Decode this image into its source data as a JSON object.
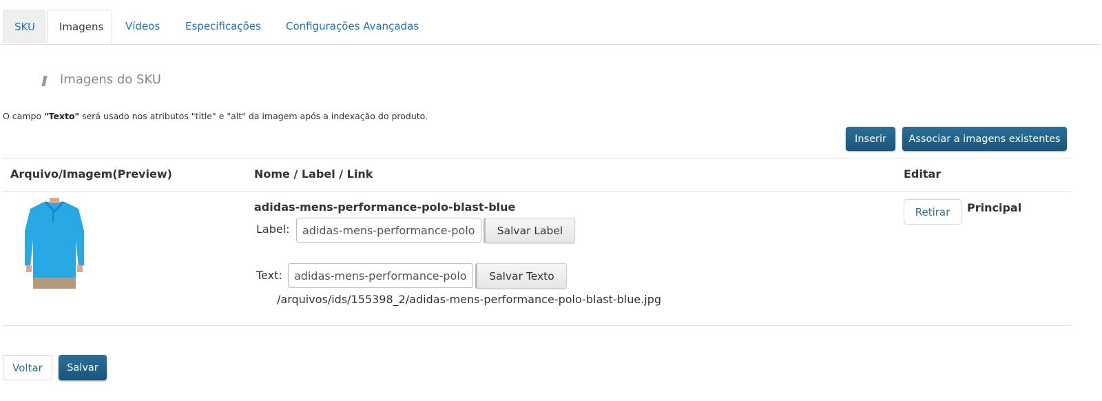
{
  "tabs": [
    {
      "label": "SKU"
    },
    {
      "label": "Imagens"
    },
    {
      "label": "Vídeos"
    },
    {
      "label": "Especificações"
    },
    {
      "label": "Configurações Avançadas"
    }
  ],
  "section": {
    "title": "Imagens do SKU"
  },
  "hint": {
    "prefix": "O campo ",
    "bold": "\"Texto\"",
    "suffix": " será usado nos atributos \"title\" e \"alt\" da imagem após a indexação do produto."
  },
  "actions": {
    "insert": "Inserir",
    "associate": "Associar a imagens existentes"
  },
  "table": {
    "headers": [
      "Arquivo/Imagem(Preview)",
      "Nome / Label / Link",
      "Editar"
    ],
    "row": {
      "name": "adidas-mens-performance-polo-blast-blue",
      "label_caption": "Label:",
      "label_value": "adidas-mens-performance-polo-blast-blue",
      "save_label": "Salvar Label",
      "text_caption": "Text:",
      "text_value": "adidas-mens-performance-polo-blast-blue",
      "save_text": "Salvar Texto",
      "path": "/arquivos/ids/155398_2/adidas-mens-performance-polo-blast-blue.jpg",
      "remove": "Retirar",
      "principal": "Principal"
    }
  },
  "footer": {
    "back": "Voltar",
    "save": "Salvar"
  },
  "colors": {
    "accent": "#1f5f85",
    "link": "#1f73b7",
    "shirt": "#29a8e6"
  }
}
